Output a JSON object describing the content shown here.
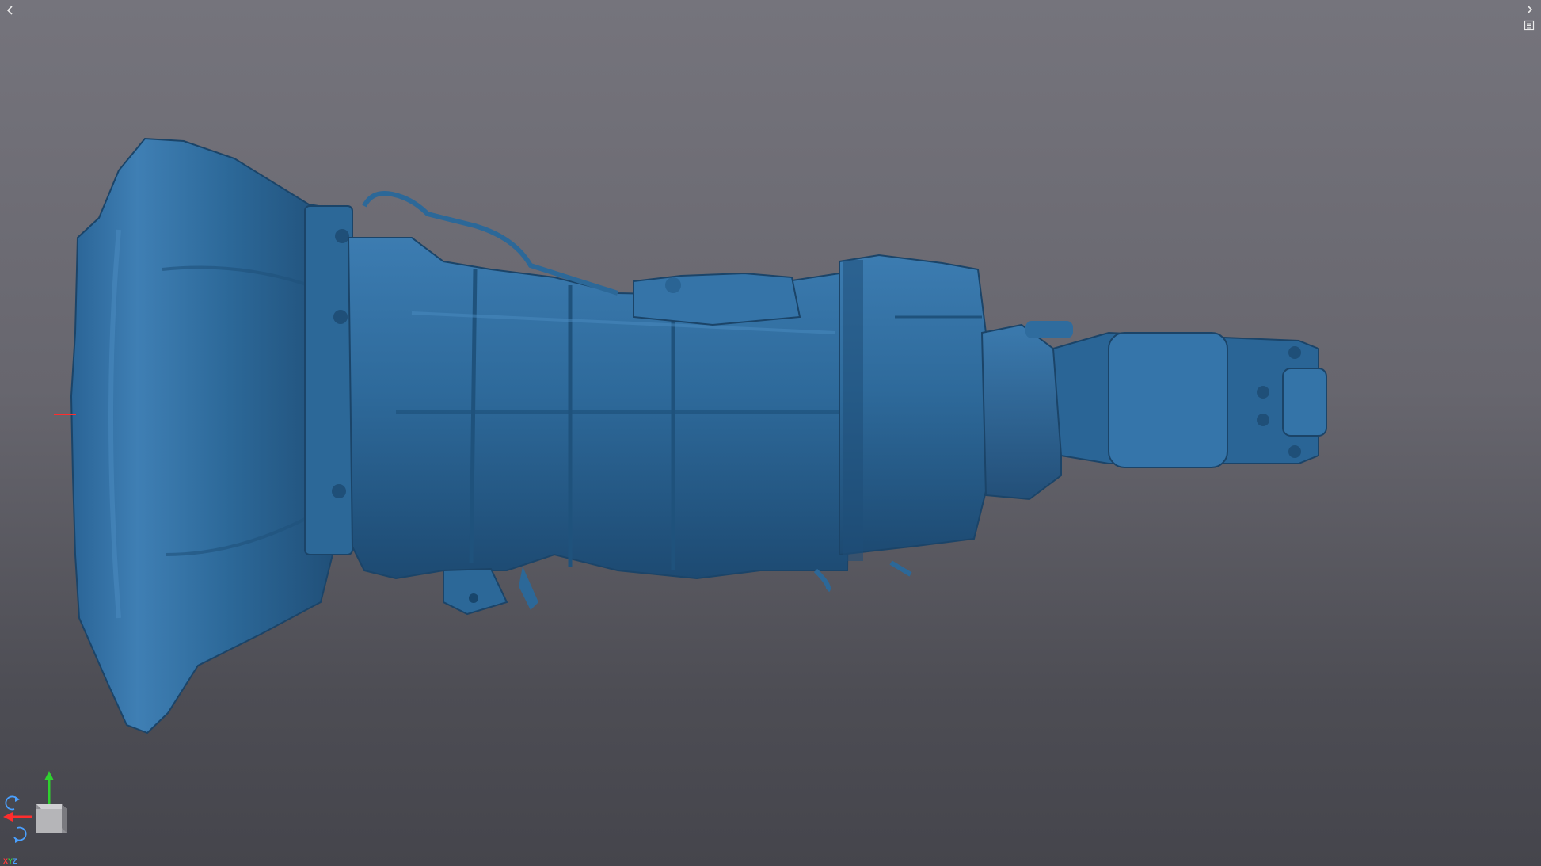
{
  "viewport": {
    "background_top": "#75747c",
    "background_bottom": "#45454c",
    "model_color": "#2d6a98",
    "model_highlight": "#4c8cc0",
    "model_shadow": "#18466c"
  },
  "controls": {
    "collapse_left_icon": "chevron-left-icon",
    "expand_right_icon": "chevron-right-icon",
    "panel_toggle_icon": "panel-icon"
  },
  "orientation_gizmo": {
    "x_label": "X",
    "y_label": "Y",
    "z_label": "Z",
    "x_color": "#ff2d2d",
    "y_color": "#2fd12f",
    "z_color": "#4aa0ff"
  }
}
